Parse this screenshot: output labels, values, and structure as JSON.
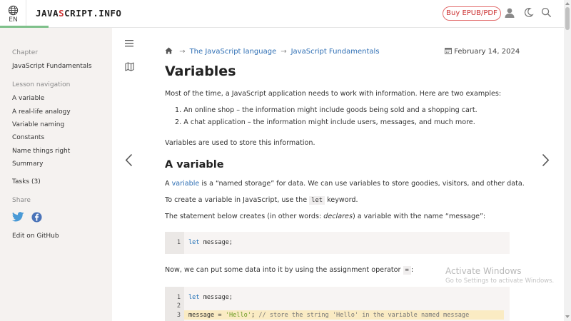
{
  "header": {
    "lang_code": "EN",
    "logo_part1": "JAVA",
    "logo_accent": "S",
    "logo_part2": "CRIPT.INFO",
    "buy_label": "Buy EPUB/PDF"
  },
  "sidebar": {
    "chapter_heading": "Chapter",
    "chapter_link": "JavaScript Fundamentals",
    "lesson_heading": "Lesson navigation",
    "lesson_items": [
      "A variable",
      "A real-life analogy",
      "Variable naming",
      "Constants",
      "Name things right",
      "Summary"
    ],
    "tasks": "Tasks (3)",
    "share_heading": "Share",
    "github": "Edit on GitHub"
  },
  "breadcrumb": {
    "sep": "→",
    "item1": "The JavaScript language",
    "item2": "JavaScript Fundamentals"
  },
  "date": "February 14, 2024",
  "article": {
    "title": "Variables",
    "intro": "Most of the time, a JavaScript application needs to work with information. Here are two examples:",
    "list": [
      "1. An online shop – the information might include goods being sold and a shopping cart.",
      "2. A chat application – the information might include users, messages, and much more."
    ],
    "used_for": "Variables are used to store this information.",
    "section_title": "A variable",
    "def_link": "variable",
    "def_rest": " is a “named storage” for data. We can use variables to store goodies, visitors, and other data.",
    "def_prefix": "A ",
    "create_pre": "To create a variable in JavaScript, use the ",
    "create_kw": "let",
    "create_post": " keyword.",
    "stmt_pre": "The statement below creates (in other words: ",
    "stmt_em": "declares",
    "stmt_post": ") a variable with the name “message”:",
    "assign_pre": "Now, we can put some data into it by using the assignment operator ",
    "assign_op": "=",
    "assign_post": ":"
  },
  "code1": {
    "line_numbers": [
      "1"
    ],
    "kw": "let",
    "rest": " message;"
  },
  "code2": {
    "line_numbers": [
      "1",
      "2",
      "3"
    ],
    "l1_kw": "let",
    "l1_rest": " message;",
    "l3_var": "message ",
    "l3_op": "=",
    "l3_str": " 'Hello'",
    "l3_semi": ";",
    "l3_comment": " // store the string 'Hello' in the variable named message"
  },
  "watermark": {
    "line1": "Activate Windows",
    "line2": "Go to Settings to activate Windows."
  },
  "colors": {
    "accent_red": "#cc3333",
    "link_blue": "#2f6fb4",
    "sidebar_bg": "#f5f2f0",
    "lang_underline": "#7ec08a"
  },
  "icons": [
    "globe-icon",
    "user-icon",
    "moon-icon",
    "search-icon",
    "menu-icon",
    "map-icon",
    "home-icon",
    "calendar-icon",
    "twitter-icon",
    "facebook-icon",
    "chevron-left-icon",
    "chevron-right-icon"
  ]
}
